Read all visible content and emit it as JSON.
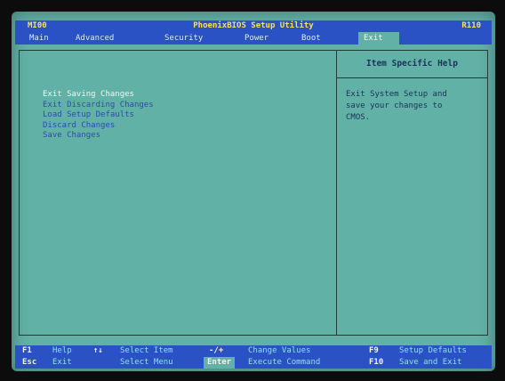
{
  "title_bar": {
    "left": "MI00",
    "center": "PhoenixBIOS Setup Utility",
    "right": "R110"
  },
  "menu": {
    "items": [
      "Main",
      "Advanced",
      "Security",
      "Power",
      "Boot",
      "Exit"
    ],
    "active": "Exit"
  },
  "options": [
    "Exit Saving Changes",
    "Exit Discarding Changes",
    "Load Setup Defaults",
    "Discard Changes",
    "Save Changes"
  ],
  "selected_option": "Exit Saving Changes",
  "help": {
    "title": "Item Specific Help",
    "text": "Exit System Setup and\nsave your changes to\nCMOS."
  },
  "footer": {
    "row1": [
      {
        "key": "F1",
        "desc": "Help"
      },
      {
        "key": "↑↓",
        "desc": "Select Item"
      },
      {
        "key": "-/+",
        "desc": "Change Values"
      },
      {
        "key": "F9",
        "desc": "Setup Defaults"
      }
    ],
    "row2": [
      {
        "key": "Esc",
        "desc": "Exit"
      },
      {
        "key": "",
        "desc": "Select Menu"
      },
      {
        "key": "Enter",
        "desc": "Execute Command"
      },
      {
        "key": "F10",
        "desc": "Save and Exit"
      }
    ]
  },
  "colors": {
    "background": "#62b1a6",
    "bar": "#2a52c4",
    "title_text": "#f6e35a",
    "option_text": "#2d4bb0",
    "help_text": "#1a3458"
  }
}
